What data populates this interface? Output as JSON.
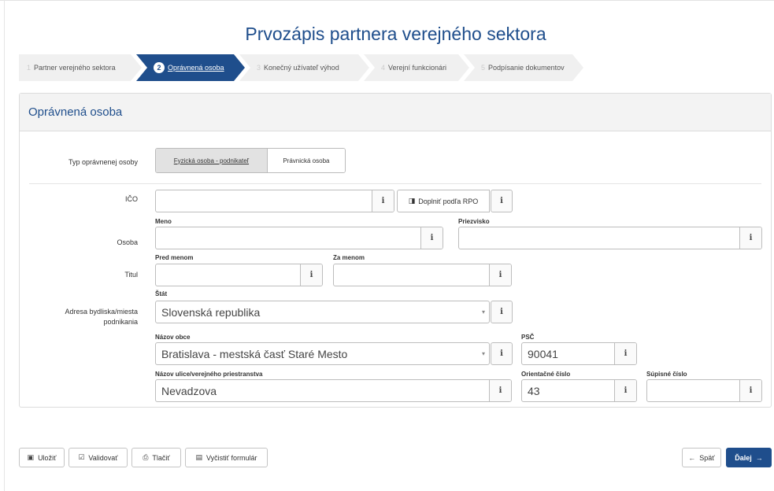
{
  "page": {
    "title": "Prvozápis partnera verejného sektora"
  },
  "wizard": {
    "steps": [
      {
        "num": "1",
        "label": "Partner verejného sektora"
      },
      {
        "num": "2",
        "label": "Oprávnená osoba"
      },
      {
        "num": "3",
        "label": "Konečný užívateľ výhod"
      },
      {
        "num": "4",
        "label": "Verejní funkcionári"
      },
      {
        "num": "5",
        "label": "Podpísanie dokumentov"
      }
    ],
    "active_step": 2
  },
  "panel": {
    "title": "Oprávnená osoba"
  },
  "form": {
    "type_label": "Typ oprávnenej osoby",
    "type_options": [
      "Fyzická osoba - podnikateľ",
      "Právnická osoba"
    ],
    "type_selected": "Fyzická osoba - podnikateľ",
    "ico_label": "IČO",
    "ico_value": "",
    "fill_button": "Doplniť podľa RPO",
    "osoba_label": "Osoba",
    "meno_label": "Meno",
    "meno_value": "",
    "priezvisko_label": "Priezvisko",
    "priezvisko_value": "",
    "titul_label": "Titul",
    "pred_menom_label": "Pred menom",
    "pred_menom_value": "",
    "za_menom_label": "Za menom",
    "za_menom_value": "",
    "adresa_label_1": "Adresa bydliska/miesta",
    "adresa_label_2": "podnikania",
    "stat_label": "Štát",
    "stat_value": "Slovenská republika",
    "obec_label": "Názov obce",
    "obec_value": "Bratislava - mestská časť Staré Mesto",
    "psc_label": "PSČ",
    "psc_value": "90041",
    "ulica_label": "Názov ulice/verejného priestranstva",
    "ulica_value": "Nevadzova",
    "orient_label": "Orientačné číslo",
    "orient_value": "43",
    "supisne_label": "Súpisné číslo",
    "supisne_value": "",
    "info_glyph": "i",
    "caret_glyph": "▾"
  },
  "actions": {
    "save": "Uložiť",
    "validate": "Validovať",
    "print": "Tlačiť",
    "clear": "Vyčistiť formulár",
    "back": "Späť",
    "next": "Ďalej"
  },
  "colors": {
    "primary": "#1f4e8c"
  },
  "icons": {
    "save": "floppy-icon",
    "validate": "check-icon",
    "print": "printer-icon",
    "clear": "document-icon",
    "back": "arrow-left-icon",
    "next": "arrow-right-icon",
    "fill": "copy-icon",
    "info": "info-icon"
  }
}
